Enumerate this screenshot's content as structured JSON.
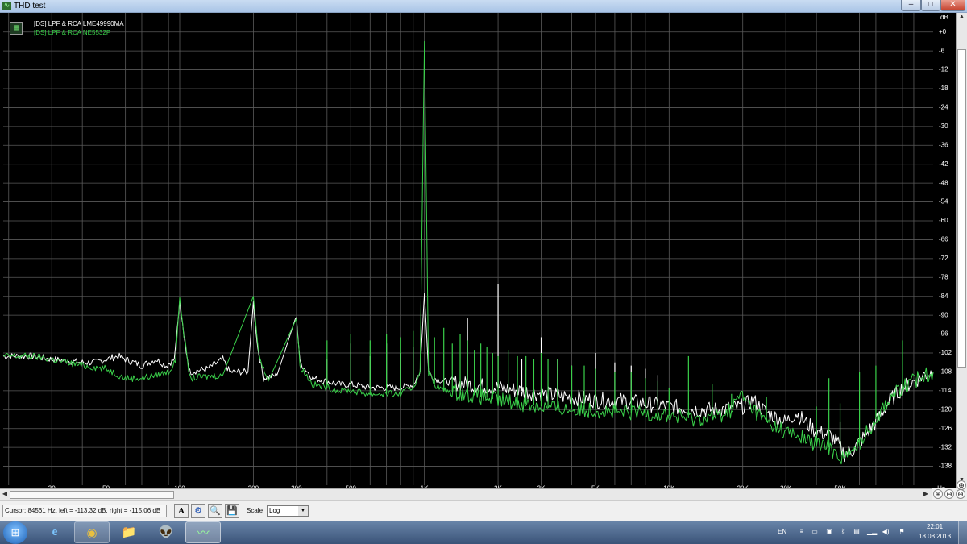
{
  "window": {
    "title": "THD test",
    "icon": "waveform-app-icon",
    "minimize": "–",
    "maximize": "□",
    "close": "✕"
  },
  "legend": {
    "icon": "grid-legend-icon",
    "glyph": "▦",
    "entries": [
      "[DS] LPF & RCA LME49990MA",
      "[DS] LPF & RCA NE5532P"
    ]
  },
  "chart_data": {
    "type": "line",
    "x_scale": "log",
    "xlim": [
      19,
      120000
    ],
    "ylim": [
      -144,
      3
    ],
    "x_unit": "Hz",
    "y_unit": "dB",
    "x_ticks": [
      {
        "v": 30,
        "t": "30"
      },
      {
        "v": 50,
        "t": "50"
      },
      {
        "v": 100,
        "t": "100"
      },
      {
        "v": 200,
        "t": "200"
      },
      {
        "v": 300,
        "t": "300"
      },
      {
        "v": 500,
        "t": "500"
      },
      {
        "v": 1000,
        "t": "1K"
      },
      {
        "v": 2000,
        "t": "2K"
      },
      {
        "v": 3000,
        "t": "3K"
      },
      {
        "v": 5000,
        "t": "5K"
      },
      {
        "v": 10000,
        "t": "10K"
      },
      {
        "v": 20000,
        "t": "20K"
      },
      {
        "v": 30000,
        "t": "30K"
      },
      {
        "v": 50000,
        "t": "50K"
      }
    ],
    "y_ticks": [
      0,
      -6,
      -12,
      -18,
      -24,
      -30,
      -36,
      -42,
      -48,
      -54,
      -60,
      -66,
      -72,
      -78,
      -84,
      -90,
      -96,
      -102,
      -108,
      -114,
      -120,
      -126,
      -132,
      -138
    ],
    "y_tick_text": [
      "+0",
      "-6",
      "-12",
      "-18",
      "-24",
      "-30",
      "-36",
      "-42",
      "-48",
      "-54",
      "-60",
      "-66",
      "-72",
      "-78",
      "-84",
      "-90",
      "-96",
      "-102",
      "-108",
      "-114",
      "-120",
      "-126",
      "-132",
      "-138"
    ],
    "grid": true,
    "legend_position": "top-left",
    "series": [
      {
        "name": "[DS] LPF & RCA LME49990MA",
        "color": "#ffffff",
        "points": [
          [
            19,
            -103
          ],
          [
            25,
            -103
          ],
          [
            30,
            -104
          ],
          [
            40,
            -105
          ],
          [
            45,
            -105
          ],
          [
            50,
            -104
          ],
          [
            56,
            -103
          ],
          [
            60,
            -104
          ],
          [
            70,
            -106
          ],
          [
            80,
            -104
          ],
          [
            88,
            -106
          ],
          [
            95,
            -104
          ],
          [
            100,
            -86
          ],
          [
            104,
            -97
          ],
          [
            110,
            -108
          ],
          [
            130,
            -107
          ],
          [
            150,
            -104
          ],
          [
            160,
            -108
          ],
          [
            190,
            -108
          ],
          [
            200,
            -86
          ],
          [
            208,
            -100
          ],
          [
            220,
            -110
          ],
          [
            250,
            -109
          ],
          [
            300,
            -90
          ],
          [
            310,
            -105
          ],
          [
            350,
            -110
          ],
          [
            400,
            -111
          ],
          [
            450,
            -112
          ],
          [
            500,
            -112
          ],
          [
            600,
            -113
          ],
          [
            700,
            -113
          ],
          [
            800,
            -113
          ],
          [
            900,
            -112
          ],
          [
            960,
            -108
          ],
          [
            1000,
            -83
          ],
          [
            1040,
            -108
          ],
          [
            1100,
            -110
          ],
          [
            1200,
            -111
          ],
          [
            1500,
            -112
          ],
          [
            2000,
            -113
          ],
          [
            2500,
            -114
          ],
          [
            3000,
            -115
          ],
          [
            4000,
            -116
          ],
          [
            5000,
            -117
          ],
          [
            6000,
            -117
          ],
          [
            8000,
            -118
          ],
          [
            10000,
            -119
          ],
          [
            13000,
            -120
          ],
          [
            16000,
            -120
          ],
          [
            20000,
            -119
          ],
          [
            22000,
            -117
          ],
          [
            25000,
            -121
          ],
          [
            30000,
            -124
          ],
          [
            33000,
            -121
          ],
          [
            36000,
            -124
          ],
          [
            40000,
            -127
          ],
          [
            45000,
            -128
          ],
          [
            48000,
            -130
          ],
          [
            52000,
            -134
          ],
          [
            56000,
            -133
          ],
          [
            62000,
            -129
          ],
          [
            70000,
            -124
          ],
          [
            80000,
            -117
          ],
          [
            90000,
            -113
          ],
          [
            100000,
            -111
          ],
          [
            110000,
            -109
          ],
          [
            120000,
            -108
          ]
        ],
        "spikes": [
          [
            400,
            -104
          ],
          [
            500,
            -99
          ],
          [
            600,
            -103
          ],
          [
            700,
            -99
          ],
          [
            800,
            -102
          ],
          [
            900,
            -100
          ],
          [
            1500,
            -91
          ],
          [
            2000,
            -80
          ],
          [
            2500,
            -104
          ],
          [
            3000,
            -97
          ],
          [
            3500,
            -104
          ],
          [
            4000,
            -106
          ],
          [
            5000,
            -102
          ],
          [
            6000,
            -105
          ],
          [
            7000,
            -106
          ],
          [
            8000,
            -107
          ],
          [
            9000,
            -109
          ],
          [
            50000,
            -124
          ]
        ]
      },
      {
        "name": "[DS] LPF & RCA NE5532P",
        "color": "#3ad04a",
        "points": [
          [
            19,
            -103
          ],
          [
            25,
            -103
          ],
          [
            30,
            -104
          ],
          [
            40,
            -106
          ],
          [
            50,
            -107
          ],
          [
            60,
            -110
          ],
          [
            70,
            -110
          ],
          [
            80,
            -109
          ],
          [
            90,
            -108
          ],
          [
            96,
            -105
          ],
          [
            100,
            -84
          ],
          [
            104,
            -96
          ],
          [
            110,
            -110
          ],
          [
            150,
            -109
          ],
          [
            200,
            -84
          ],
          [
            210,
            -102
          ],
          [
            230,
            -111
          ],
          [
            300,
            -91
          ],
          [
            310,
            -106
          ],
          [
            350,
            -112
          ],
          [
            400,
            -113
          ],
          [
            450,
            -114
          ],
          [
            500,
            -114
          ],
          [
            600,
            -115
          ],
          [
            700,
            -115
          ],
          [
            800,
            -115
          ],
          [
            900,
            -113
          ],
          [
            960,
            -108
          ],
          [
            1000,
            -3
          ],
          [
            1040,
            -108
          ],
          [
            1100,
            -112
          ],
          [
            1200,
            -114
          ],
          [
            1500,
            -115
          ],
          [
            2000,
            -117
          ],
          [
            2500,
            -118
          ],
          [
            3000,
            -119
          ],
          [
            4000,
            -120
          ],
          [
            5000,
            -120
          ],
          [
            6000,
            -121
          ],
          [
            8000,
            -121
          ],
          [
            10000,
            -122
          ],
          [
            13000,
            -123
          ],
          [
            16000,
            -122
          ],
          [
            18000,
            -120
          ],
          [
            19500,
            -115
          ],
          [
            21000,
            -118
          ],
          [
            25000,
            -124
          ],
          [
            30000,
            -127
          ],
          [
            35000,
            -129
          ],
          [
            40000,
            -131
          ],
          [
            45000,
            -132
          ],
          [
            50000,
            -135
          ],
          [
            56000,
            -134
          ],
          [
            62000,
            -129
          ],
          [
            70000,
            -123
          ],
          [
            80000,
            -116
          ],
          [
            90000,
            -113
          ],
          [
            100000,
            -111
          ],
          [
            110000,
            -109
          ],
          [
            120000,
            -108
          ]
        ],
        "spikes": [
          [
            200,
            -84
          ],
          [
            300,
            -91
          ],
          [
            400,
            -98
          ],
          [
            500,
            -96
          ],
          [
            600,
            -98
          ],
          [
            700,
            -96
          ],
          [
            800,
            -97
          ],
          [
            900,
            -95
          ],
          [
            1100,
            -97
          ],
          [
            1200,
            -94
          ],
          [
            1300,
            -99
          ],
          [
            1400,
            -96
          ],
          [
            1500,
            -98
          ],
          [
            1600,
            -101
          ],
          [
            1700,
            -99
          ],
          [
            1800,
            -100
          ],
          [
            1900,
            -102
          ],
          [
            2000,
            -103
          ],
          [
            2200,
            -101
          ],
          [
            2400,
            -103
          ],
          [
            2600,
            -103
          ],
          [
            2800,
            -104
          ],
          [
            3000,
            -102
          ],
          [
            3200,
            -104
          ],
          [
            3500,
            -104
          ],
          [
            4000,
            -106
          ],
          [
            4500,
            -106
          ],
          [
            5000,
            -107
          ],
          [
            6000,
            -108
          ],
          [
            7000,
            -108
          ],
          [
            8000,
            -110
          ],
          [
            9000,
            -111
          ],
          [
            10000,
            -113
          ],
          [
            12000,
            -103
          ],
          [
            15000,
            -112
          ],
          [
            18000,
            -115
          ],
          [
            25000,
            -116
          ],
          [
            40000,
            -119
          ],
          [
            45000,
            -110
          ],
          [
            50000,
            -118
          ],
          [
            60000,
            -108
          ],
          [
            70000,
            -106
          ],
          [
            90000,
            -98
          ]
        ]
      }
    ]
  },
  "status": {
    "cursor": "Cursor:  84561 Hz,  left = -113.32 dB,  right = -115.06 dB",
    "scale_label": "Scale",
    "scale_value": "Log",
    "tools": [
      "A",
      "⚙",
      "🔍",
      "💾"
    ]
  },
  "zoom": [
    "⊕",
    "⊕",
    "⊖",
    "⊖"
  ],
  "taskbar": {
    "start": "⊞",
    "apps": [
      "e",
      "◉",
      "📁",
      "👽",
      "〰"
    ],
    "lang": "EN",
    "time": "22:01",
    "date": "18.08.2013"
  },
  "colors": {
    "plot_bg": "#000000",
    "grid": "#5a5a5a",
    "axis_text": "#ffffff"
  }
}
